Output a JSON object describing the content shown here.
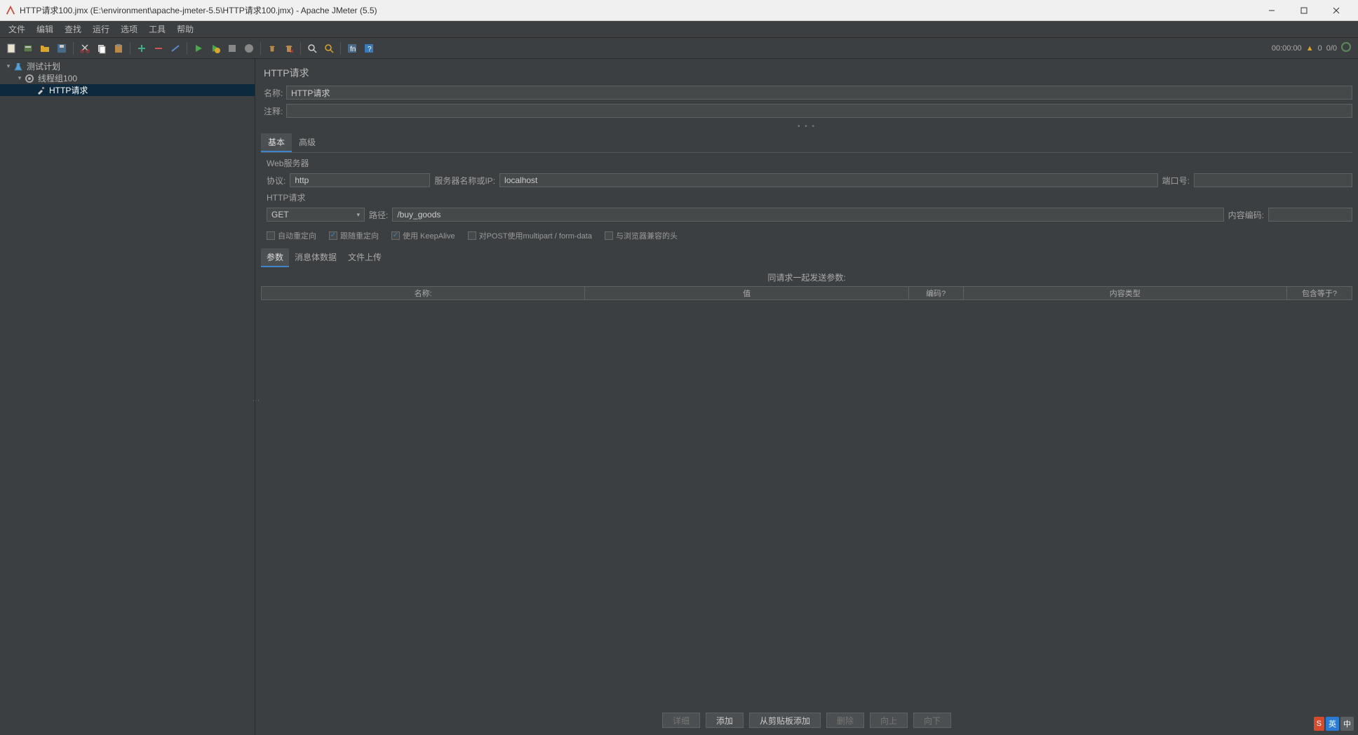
{
  "window": {
    "title": "HTTP请求100.jmx (E:\\environment\\apache-jmeter-5.5\\HTTP请求100.jmx) - Apache JMeter (5.5)"
  },
  "menu": {
    "file": "文件",
    "edit": "编辑",
    "search": "查找",
    "run": "运行",
    "options": "选项",
    "tools": "工具",
    "help": "帮助"
  },
  "toolbar_status": {
    "time": "00:00:00",
    "active": "0",
    "counts": "0/0"
  },
  "tree": {
    "root": "测试计划",
    "group": "线程组100",
    "sampler": "HTTP请求"
  },
  "panel": {
    "title": "HTTP请求",
    "label_name": "名称:",
    "name_value": "HTTP请求",
    "label_comment": "注释:",
    "comment_value": "",
    "tab_basic": "基本",
    "tab_advanced": "高级",
    "web_server_section": "Web服务器",
    "label_protocol": "协议:",
    "protocol_value": "http",
    "label_server": "服务器名称或IP:",
    "server_value": "localhost",
    "label_port": "端口号:",
    "port_value": "",
    "http_request_section": "HTTP请求",
    "method_value": "GET",
    "label_path": "路径:",
    "path_value": "/buy_goods",
    "label_encoding": "内容编码:",
    "encoding_value": "",
    "chk_auto_redirect": "自动重定向",
    "chk_follow_redirect": "跟随重定向",
    "chk_keepalive": "使用 KeepAlive",
    "chk_multipart": "对POST使用multipart / form-data",
    "chk_browser_headers": "与浏览器兼容的头",
    "subtab_params": "参数",
    "subtab_body": "消息体数据",
    "subtab_files": "文件上传",
    "params_heading": "同请求一起发送参数:",
    "col_name": "名称:",
    "col_value": "值",
    "col_encode": "编码?",
    "col_content_type": "内容类型",
    "col_include_equals": "包含等于?",
    "btn_detail": "详细",
    "btn_add": "添加",
    "btn_from_clip": "从剪贴板添加",
    "btn_delete": "删除",
    "btn_up": "向上",
    "btn_down": "向下"
  },
  "ime": {
    "s": "S",
    "en": "英",
    "cn": "中"
  }
}
